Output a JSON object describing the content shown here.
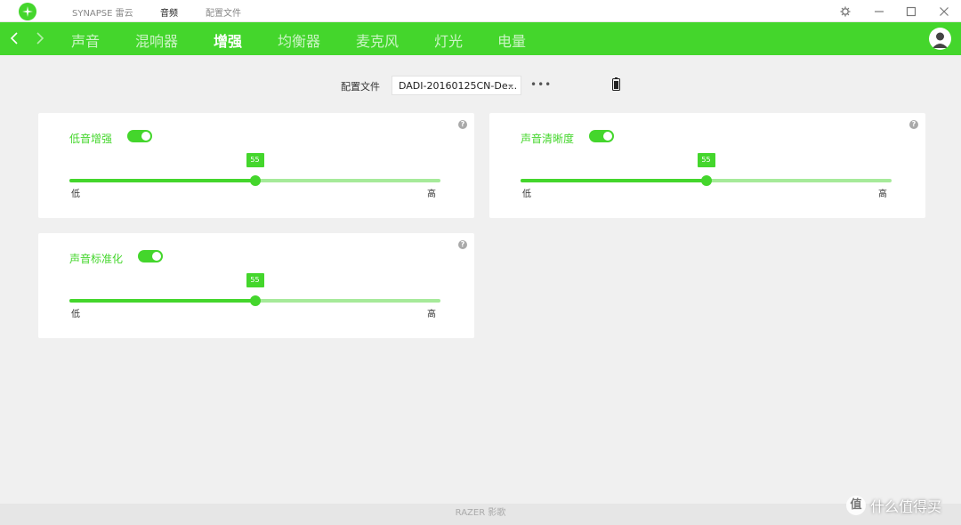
{
  "titlebar": {
    "app_name": "SYNAPSE 雷云",
    "tabs": [
      {
        "label": "音频",
        "active": true
      },
      {
        "label": "配置文件",
        "active": false
      }
    ]
  },
  "navbar": {
    "tabs": [
      {
        "label": "声音",
        "active": false
      },
      {
        "label": "混响器",
        "active": false
      },
      {
        "label": "增强",
        "active": true
      },
      {
        "label": "均衡器",
        "active": false
      },
      {
        "label": "麦克风",
        "active": false
      },
      {
        "label": "灯光",
        "active": false
      },
      {
        "label": "电量",
        "active": false
      }
    ]
  },
  "profile": {
    "label": "配置文件",
    "selected": "DADI-20160125CN-De...",
    "more": "•••"
  },
  "help_symbol": "?",
  "cards": [
    {
      "title": "低音增强",
      "enabled": true,
      "value": 55,
      "value_label": "55",
      "min_label": "低",
      "max_label": "高"
    },
    {
      "title": "声音清晰度",
      "enabled": true,
      "value": 55,
      "value_label": "55",
      "min_label": "低",
      "max_label": "高"
    },
    {
      "title": "声音标准化",
      "enabled": true,
      "value": 55,
      "value_label": "55",
      "min_label": "低",
      "max_label": "高"
    }
  ],
  "footer": {
    "text": "RAZER 影歌"
  },
  "watermark": {
    "logo_char": "值",
    "text": "什么值得买"
  },
  "colors": {
    "accent": "#44d62c",
    "track_light": "#a6ea9a",
    "background": "#f0f0f0",
    "card": "#ffffff"
  }
}
